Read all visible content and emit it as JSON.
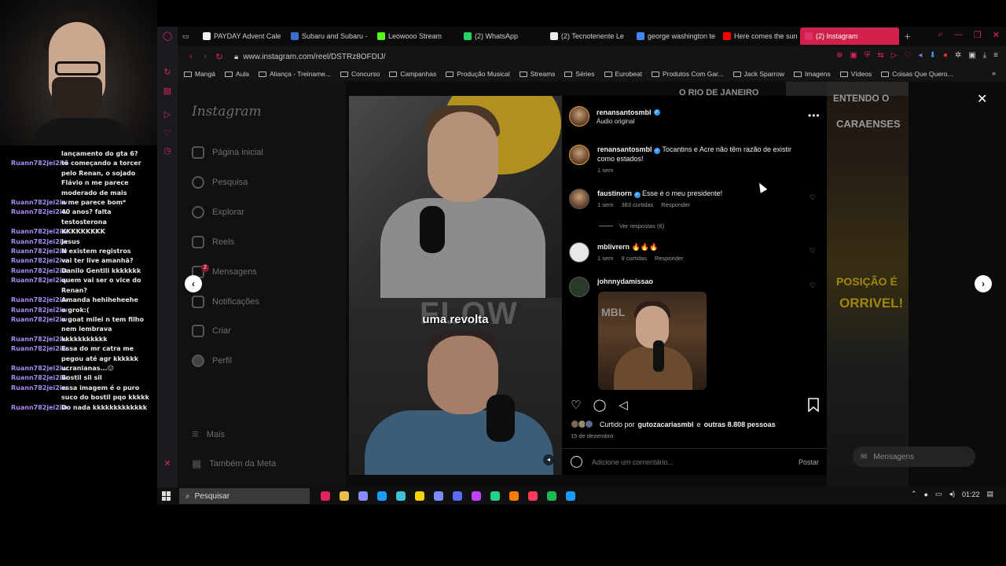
{
  "chat": {
    "first_message": "lançamento do gta 6?",
    "messages": [
      {
        "user": "Ruann782jei2iw",
        "text": "tô começando a torcer pelo Renan, o sojado Flávio n me parece moderado de mais"
      },
      {
        "user": "Ruann782jei2iw",
        "text": "n me parece bom*"
      },
      {
        "user": "Ruann782jei2iw",
        "text": "40 anos? falta testosterona"
      },
      {
        "user": "Ruann782jei2iw",
        "text": "KKKKKKKKK"
      },
      {
        "user": "Ruann782jei2iw",
        "text": "Jesus"
      },
      {
        "user": "Ruann782jei2iw",
        "text": "N existem registros"
      },
      {
        "user": "Ruann782jei2iw",
        "text": "vai ter live amanhã?"
      },
      {
        "user": "Ruann782jei2iw",
        "text": "Danilo Gentili kkkkkkk"
      },
      {
        "user": "Ruann782jei2iw",
        "text": "quem vai ser o vice do Renan?"
      },
      {
        "user": "Ruann782jei2iw",
        "text": "Amanda hehiheheehe"
      },
      {
        "user": "Ruann782jei2iw",
        "text": "o grok:("
      },
      {
        "user": "Ruann782jei2iw",
        "text": "o goat milei n tem filho nem lembrava"
      },
      {
        "user": "Ruann782jei2iw",
        "text": "kkkkkkkkkkk"
      },
      {
        "user": "Ruann782jei2iw",
        "text": "Essa do mr catra me pegou até agr kkkkkk"
      },
      {
        "user": "Ruann782jei2iw",
        "text": "ucranianas...😐"
      },
      {
        "user": "Ruann782jei2iw",
        "text": "Bostil sil sil"
      },
      {
        "user": "Ruann782jei2iw",
        "text": "essa imagem é o puro suco do bostil pqo kkkkk"
      },
      {
        "user": "Ruann782jei2iw",
        "text": "Do nada kkkkkkkkkkkkk"
      }
    ]
  },
  "browser": {
    "tabs": [
      {
        "label": "PAYDAY Advent Cale",
        "color": "#f0f0f0"
      },
      {
        "label": "Subaru and Subaru -",
        "color": "#3b6fd1"
      },
      {
        "label": "Leowooo Stream",
        "color": "#53fc18"
      },
      {
        "label": "(2) WhatsApp",
        "color": "#25d366"
      },
      {
        "label": "(2) Tecnotenente Le",
        "color": "#eeeeee"
      },
      {
        "label": "george washington te",
        "color": "#4285f4"
      },
      {
        "label": "Here comes the sun",
        "color": "#ff0000"
      },
      {
        "label": "(2) Instagram",
        "color": "#e1306c",
        "active": true
      }
    ],
    "url": "www.instagram.com/reel/DSTRz8OFDIJ/",
    "bookmarks": [
      "Mangá",
      "Aula",
      "Aliança - Treiname...",
      "Concurso",
      "Campanhas",
      "Produção Musical",
      "Streams",
      "Séries",
      "Eurobeat",
      "Produtos Com Gar...",
      "Jack Sparrow",
      "Imagens",
      "Vídeos",
      "Coisas Que Quero..."
    ]
  },
  "instagram": {
    "logo": "Instagram",
    "nav": [
      {
        "label": "Página inicial",
        "icon": "home-icon"
      },
      {
        "label": "Pesquisa",
        "icon": "search-icon"
      },
      {
        "label": "Explorar",
        "icon": "compass-icon"
      },
      {
        "label": "Reels",
        "icon": "reels-icon"
      },
      {
        "label": "Mensagens",
        "icon": "messenger-icon",
        "badge": "2"
      },
      {
        "label": "Notificações",
        "icon": "heart-icon"
      },
      {
        "label": "Criar",
        "icon": "plus-icon"
      },
      {
        "label": "Perfil",
        "icon": "profile-icon"
      }
    ],
    "nav_more": "Mais",
    "nav_meta": "Também da Meta",
    "messages_pill": "Mensagens",
    "background_texts": [
      "O RIO DE JANEIRO",
      "ENTENDO O",
      "CARAENSES",
      "POSIÇÃO É",
      "ORRIVEL!"
    ]
  },
  "reel": {
    "caption": "uma revolta",
    "watermark": "FLOW",
    "author": "renansantosmbl",
    "audio": "Áudio original",
    "description": "Tocantins e Acre não têm razão de existir como estados!",
    "description_time": "1 sem",
    "comments": [
      {
        "user": "faustinorn",
        "verified": true,
        "text": "Esse é o meu presidente!",
        "time": "1 sem",
        "likes": "383 curtidas",
        "reply": "Responder",
        "view_replies": "Ver respostas (6)"
      },
      {
        "user": "mblivrern",
        "verified": false,
        "text": "🔥🔥🔥",
        "time": "1 sem",
        "likes": "9 curtidas",
        "reply": "Responder"
      },
      {
        "user": "johnnydamissao",
        "verified": false,
        "text": "",
        "gif_text": "MBL"
      }
    ],
    "liked_prefix": "Curtido por",
    "liked_user": "gutozacariasmbl",
    "liked_suffix": "e",
    "liked_others": "outras 8.808 pessoas",
    "date": "15 de dezembro",
    "comment_placeholder": "Adicione um comentário...",
    "post_label": "Postar"
  },
  "taskbar": {
    "search_label": "Pesquisar",
    "time": "01:22",
    "icon_colors": [
      "#e0245e",
      "#e8c04a",
      "#8a8aff",
      "#1b9aff",
      "#3ec1d3",
      "#f5d300",
      "#7a8bff",
      "#5a6bff",
      "#c040ff",
      "#23d18b",
      "#ff7a00",
      "#ff3b5c",
      "#1db954",
      "#1b9aff"
    ]
  },
  "colors": {
    "accent": "#e0245e",
    "instagram_blue": "#3897f0",
    "chat_user": "#a78bf2"
  }
}
